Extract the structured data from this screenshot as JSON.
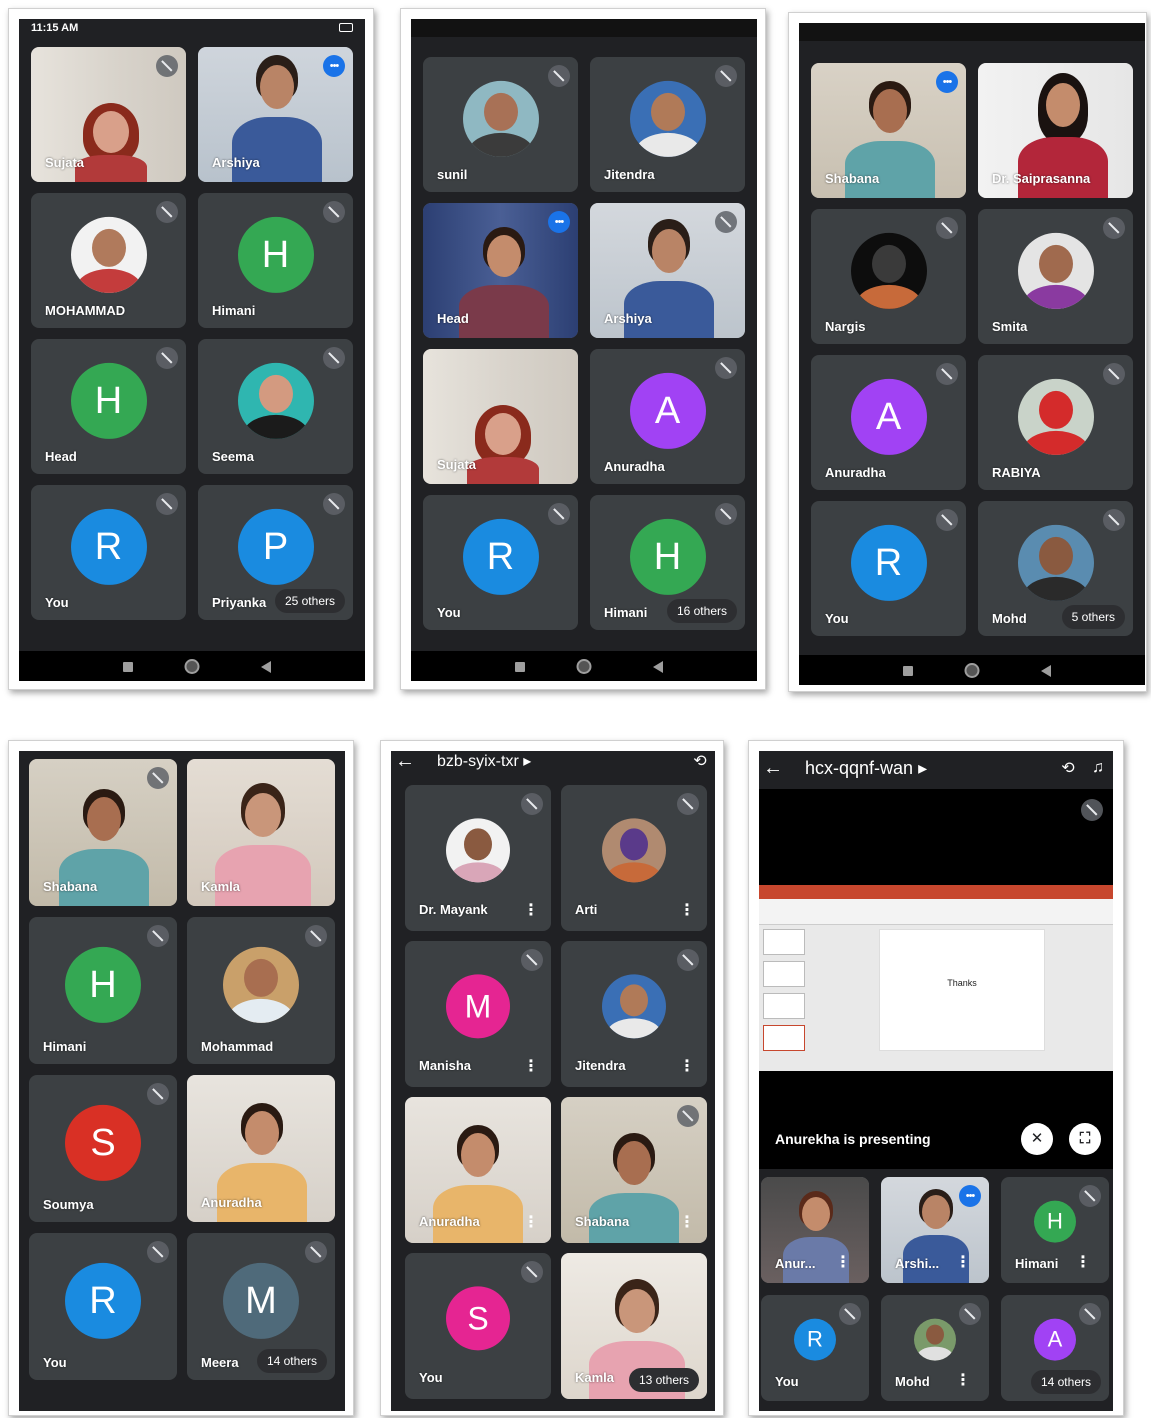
{
  "colors": {
    "tile_bg": "#3c4043",
    "screen_bg": "#202124",
    "avatar_green": "#34a853",
    "avatar_blue": "#1a8be0",
    "avatar_purple": "#a142f4",
    "avatar_red": "#d93025",
    "avatar_pink": "#e52592",
    "avatar_slate": "#4f6a7a",
    "speaking_blue": "#1a73e8"
  },
  "screens": {
    "s1": {
      "status_time": "11:15 AM",
      "tiles": [
        {
          "name": "Sujata",
          "type": "video"
        },
        {
          "name": "Arshiya",
          "type": "video"
        },
        {
          "name": "MOHAMMAD",
          "type": "photo"
        },
        {
          "name": "Himani",
          "letter": "H"
        },
        {
          "name": "Head",
          "letter": "H"
        },
        {
          "name": "Seema",
          "type": "photo"
        },
        {
          "name": "You",
          "letter": "R"
        },
        {
          "name": "Priyanka",
          "letter": "P",
          "others": "25 others"
        }
      ]
    },
    "s2": {
      "tiles": [
        {
          "name": "sunil",
          "type": "photo"
        },
        {
          "name": "Jitendra",
          "type": "photo"
        },
        {
          "name": "Head",
          "type": "video"
        },
        {
          "name": "Arshiya",
          "type": "video"
        },
        {
          "name": "Sujata",
          "type": "video"
        },
        {
          "name": "Anuradha",
          "letter": "A"
        },
        {
          "name": "You",
          "letter": "R"
        },
        {
          "name": "Himani",
          "letter": "H",
          "others": "16 others"
        }
      ]
    },
    "s3": {
      "tiles": [
        {
          "name": "Shabana",
          "type": "video"
        },
        {
          "name": "Dr. Saiprasanna",
          "type": "video"
        },
        {
          "name": "Nargis",
          "type": "photo"
        },
        {
          "name": "Smita",
          "type": "photo"
        },
        {
          "name": "Anuradha",
          "letter": "A"
        },
        {
          "name": "RABIYA",
          "type": "photo"
        },
        {
          "name": "You",
          "letter": "R"
        },
        {
          "name": "Mohd",
          "type": "photo",
          "others": "5 others"
        }
      ]
    },
    "s4": {
      "tiles": [
        {
          "name": "Shabana",
          "type": "video"
        },
        {
          "name": "Kamla",
          "type": "video"
        },
        {
          "name": "Himani",
          "letter": "H"
        },
        {
          "name": "Mohammad",
          "type": "photo"
        },
        {
          "name": "Soumya",
          "letter": "S"
        },
        {
          "name": "Anuradha",
          "type": "video"
        },
        {
          "name": "You",
          "letter": "R"
        },
        {
          "name": "Meera",
          "letter": "M",
          "others": "14 others"
        }
      ]
    },
    "s5": {
      "meeting_code": "bzb-syix-txr",
      "tiles": [
        {
          "name": "Dr. Mayank",
          "type": "photo"
        },
        {
          "name": "Arti",
          "type": "photo"
        },
        {
          "name": "Manisha",
          "letter": "M"
        },
        {
          "name": "Jitendra",
          "type": "photo"
        },
        {
          "name": "Anuradha",
          "type": "video"
        },
        {
          "name": "Shabana",
          "type": "video"
        },
        {
          "name": "You",
          "letter": "S"
        },
        {
          "name": "Kamla",
          "type": "video",
          "others": "13 others"
        }
      ]
    },
    "s6": {
      "meeting_code": "hcx-qqnf-wan",
      "presenting": "Anurekha is presenting",
      "slide_text": "Thanks",
      "tiles": [
        {
          "name": "Anur...",
          "type": "video"
        },
        {
          "name": "Arshi...",
          "type": "video"
        },
        {
          "name": "Himani",
          "letter": "H"
        },
        {
          "name": "You",
          "letter": "R"
        },
        {
          "name": "Mohd",
          "type": "photo"
        },
        {
          "name": "A",
          "letter": "A",
          "others": "14 others"
        }
      ]
    }
  },
  "icons": {
    "back": "←",
    "dropdown": "▸",
    "more": "⋮",
    "camera_switch": "⟲",
    "audio": "♫",
    "mic_off": "🎙",
    "fullscreen": "⛶"
  }
}
